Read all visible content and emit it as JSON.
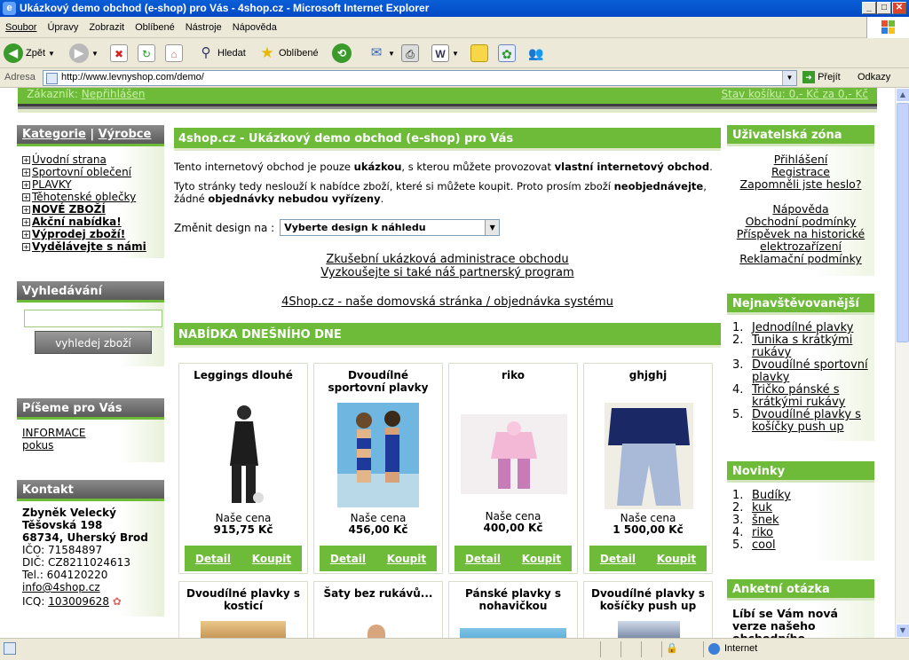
{
  "window": {
    "title": "Ukázkový demo obchod (e-shop) pro Vás - 4shop.cz - Microsoft Internet Explorer"
  },
  "menu": [
    "Soubor",
    "Úpravy",
    "Zobrazit",
    "Oblíbené",
    "Nástroje",
    "Nápověda"
  ],
  "toolbar": {
    "back": "Zpět",
    "search": "Hledat",
    "favorites": "Oblíbené"
  },
  "address": {
    "label": "Adresa",
    "url": "http://www.levnyshop.com/demo/",
    "go": "Přejít",
    "links": "Odkazy"
  },
  "top_bar": {
    "customer_label": "Zákazník:",
    "customer_value": "Nepřihlášen",
    "cart": "Stav košíku: 0,- Kč za 0,- Kč"
  },
  "left": {
    "categories_head": "Kategorie",
    "separator": "|",
    "makers_head": "Výrobce",
    "categories": [
      {
        "label": "Úvodní strana",
        "bold": false
      },
      {
        "label": "Sportovní oblečení",
        "bold": false
      },
      {
        "label": "PLAVKY",
        "bold": false
      },
      {
        "label": "Těhotenské oblečky",
        "bold": false
      },
      {
        "label": "NOVÉ ZBOŽÍ",
        "bold": true
      },
      {
        "label": "Akční nabídka!",
        "bold": true
      },
      {
        "label": "Výprodej zboží!",
        "bold": true
      },
      {
        "label": "Vydělávejte s námi",
        "bold": true
      }
    ],
    "search_head": "Vyhledávání",
    "search_button": "vyhledej zboží",
    "write_head": "Píšeme pro Vás",
    "write_links": [
      "INFORMACE",
      "pokus"
    ],
    "contact_head": "Kontakt",
    "contact": {
      "name": "Zbyněk Velecký",
      "street": "Těšovská 198",
      "city": "68734, Uherský Brod",
      "ico": "IČO: 71584897",
      "dic": "DIČ: CZ8211024613",
      "tel": "Tel.: 604120220",
      "email": "info@4shop.cz",
      "icq_label": "ICQ:",
      "icq": "103009628"
    }
  },
  "center": {
    "title": "4shop.cz - Ukázkový demo obchod (e-shop) pro Vás",
    "intro1_a": "Tento internetový obchod je pouze ",
    "intro1_b": "ukázkou",
    "intro1_c": ", s kterou můžete provozovat ",
    "intro1_d": "vlastní internetový obchod",
    "intro1_e": ".",
    "intro2_a": "Tyto stránky tedy neslouží k nabídce zboží, které si můžete koupit. Proto prosím zboží ",
    "intro2_b": "neobjednávejte",
    "intro2_c": ", žádné ",
    "intro2_d": "objednávky nebudou vyřízeny",
    "intro2_e": ".",
    "design_label": "Změnit design na :",
    "design_select": "Vyberte design k náhledu",
    "link_admin": "Zkušební ukázková administrace obchodu",
    "link_partner": "Vyzkoušejte si také náš partnerský program",
    "link_home": "4Shop.cz - naše domovská stránka / objednávka systému",
    "offer_title": "NABÍDKA DNEŠNÍHO DNE",
    "products": [
      {
        "name": "Leggings dlouhé",
        "price_label": "Naše cena",
        "price": "915,75 Kč",
        "detail": "Detail",
        "buy": "Koupit"
      },
      {
        "name": "Dvoudílné sportovní plavky",
        "price_label": "Naše cena",
        "price": "456,00 Kč",
        "detail": "Detail",
        "buy": "Koupit"
      },
      {
        "name": "riko",
        "price_label": "Naše cena",
        "price": "400,00 Kč",
        "detail": "Detail",
        "buy": "Koupit"
      },
      {
        "name": "ghjghj",
        "price_label": "Naše cena",
        "price": "1 500,00 Kč",
        "detail": "Detail",
        "buy": "Koupit"
      }
    ],
    "products2": [
      {
        "name": "Dvoudílné plavky s kosticí"
      },
      {
        "name": "Šaty bez rukávů..."
      },
      {
        "name": "Pánské plavky s nohavičkou"
      },
      {
        "name": "Dvoudílné plavky s košíčky push up"
      }
    ]
  },
  "right": {
    "user_head": "Uživatelská zóna",
    "user_links": [
      "Přihlášení",
      "Registrace",
      "Zapomněli jste heslo?"
    ],
    "info_links": [
      "Nápověda",
      "Obchodní podmínky",
      "Příspěvek na historické elektrozařízení",
      "Reklamační podmínky"
    ],
    "top_head": "Nejnavštěvovanější",
    "top": [
      {
        "n": "1.",
        "v": "Jednodílné plavky"
      },
      {
        "n": "2.",
        "v": "Tunika s krátkými rukávy"
      },
      {
        "n": "3.",
        "v": "Dvoudílné sportovní plavky"
      },
      {
        "n": "4.",
        "v": "Tričko pánské s krátkými rukávy"
      },
      {
        "n": "5.",
        "v": "Dvoudílné plavky s košíčky push up"
      }
    ],
    "news_head": "Novinky",
    "news": [
      {
        "n": "1.",
        "v": "Budíky"
      },
      {
        "n": "2.",
        "v": "kuk"
      },
      {
        "n": "3.",
        "v": "šnek"
      },
      {
        "n": "4.",
        "v": "riko"
      },
      {
        "n": "5.",
        "v": "cool"
      }
    ],
    "poll_head": "Anketní otázka",
    "poll_text": "Líbí se Vám nová verze našeho obchodního"
  },
  "status": {
    "zone": "Internet"
  }
}
